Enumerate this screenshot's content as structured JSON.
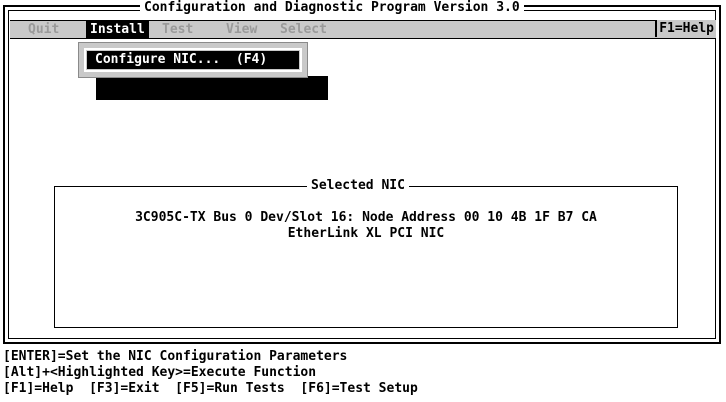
{
  "window": {
    "title": "Configuration and Diagnostic Program Version 3.0"
  },
  "menubar": {
    "items": [
      {
        "label": "Quit",
        "state": "dim"
      },
      {
        "label": "Install",
        "state": "selected"
      },
      {
        "label": "Test",
        "state": "dim"
      },
      {
        "label": "View",
        "state": "dim"
      },
      {
        "label": "Select",
        "state": "dim"
      }
    ],
    "help": "F1=Help"
  },
  "install_menu": {
    "items": [
      {
        "label": "Configure NIC...  (F4)"
      }
    ]
  },
  "selected_nic": {
    "title": "Selected NIC",
    "line1": "3C905C-TX Bus 0 Dev/Slot 16: Node Address 00 10 4B 1F B7 CA",
    "line2": "EtherLink XL PCI NIC"
  },
  "status": {
    "lines": [
      "[ENTER]=Set the NIC Configuration Parameters",
      "[Alt]+<Highlighted Key>=Execute Function",
      "[F1]=Help  [F3]=Exit  [F5]=Run Tests  [F6]=Test Setup"
    ]
  },
  "colors": {
    "menubar_bg": "#c9c9c9",
    "dim_text": "#9a9a9a",
    "highlight_bg": "#000000",
    "highlight_fg": "#ffffff"
  }
}
